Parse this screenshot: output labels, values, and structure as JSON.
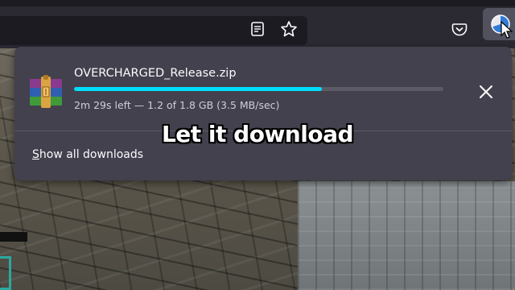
{
  "toolbar": {
    "reader_icon": "reader-view-icon",
    "bookmark_icon": "star-icon",
    "pocket_icon": "pocket-icon",
    "downloads_icon": "downloads-progress-icon"
  },
  "download": {
    "filename": "OVERCHARGED_Release.zip",
    "status": "2m 29s left — 1.2 of 1.8 GB (3.5 MB/sec)",
    "progress_fraction": 0.67,
    "file_icon": "winrar-archive-icon",
    "close_icon": "close-icon"
  },
  "panel": {
    "show_all_first": "S",
    "show_all_rest": "how all downloads"
  },
  "overlay": {
    "caption": "Let it download"
  },
  "colors": {
    "panel_bg": "#42414d",
    "progress_accent": "#00ddff",
    "toolbar_bg": "#2b2a33"
  }
}
